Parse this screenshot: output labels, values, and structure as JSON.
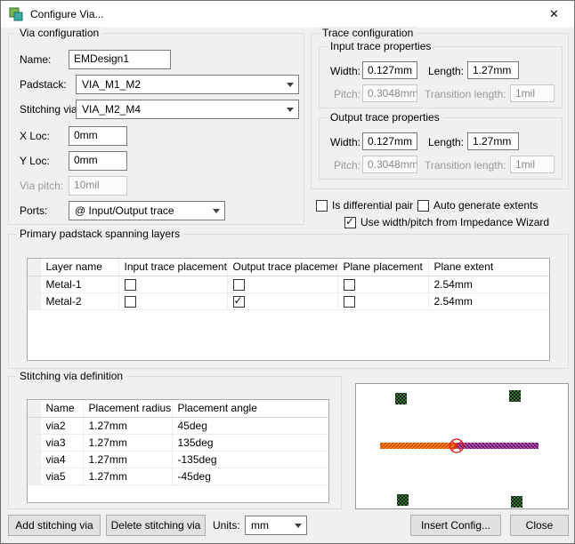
{
  "window": {
    "title": "Configure Via...",
    "close_icon": "✕"
  },
  "via_config": {
    "title": "Via configuration",
    "name_label": "Name:",
    "name_value": "EMDesign1",
    "padstack_label": "Padstack:",
    "padstack_value": "VIA_M1_M2",
    "stitching_label": "Stitching via:",
    "stitching_value": "VIA_M2_M4",
    "xloc_label": "X Loc:",
    "xloc_value": "0mm",
    "yloc_label": "Y Loc:",
    "yloc_value": "0mm",
    "viapitch_label": "Via pitch:",
    "viapitch_value": "10mil",
    "ports_label": "Ports:",
    "ports_value": "@ Input/Output trace"
  },
  "trace_config": {
    "title": "Trace configuration",
    "input": {
      "title": "Input trace properties",
      "width_label": "Width:",
      "width_value": "0.127mm",
      "length_label": "Length:",
      "length_value": "1.27mm",
      "pitch_label": "Pitch:",
      "pitch_value": "0.3048mm",
      "transition_label": "Transition length:",
      "transition_value": "1mil"
    },
    "output": {
      "title": "Output trace properties",
      "width_label": "Width:",
      "width_value": "0.127mm",
      "length_label": "Length:",
      "length_value": "1.27mm",
      "pitch_label": "Pitch:",
      "pitch_value": "0.3048mm",
      "transition_label": "Transition length:",
      "transition_value": "1mil"
    },
    "diff_pair_label": "Is differential pair",
    "diff_pair_checked": false,
    "auto_extents_label": "Auto generate extents",
    "auto_extents_checked": false,
    "impedance_label": "Use width/pitch from Impedance Wizard",
    "impedance_checked": true
  },
  "padstack_layers": {
    "title": "Primary padstack spanning layers",
    "columns": [
      "Layer name",
      "Input trace placement",
      "Output trace placement",
      "Plane placement",
      "Plane extent"
    ],
    "rows": [
      {
        "layer": "Metal-1",
        "input": false,
        "output": false,
        "plane": false,
        "extent": "2.54mm"
      },
      {
        "layer": "Metal-2",
        "input": false,
        "output": true,
        "plane": false,
        "extent": "2.54mm"
      }
    ]
  },
  "stitching": {
    "title": "Stitching via definition",
    "columns": [
      "Name",
      "Placement radius",
      "Placement angle"
    ],
    "rows": [
      {
        "name": "via2",
        "radius": "1.27mm",
        "angle": "45deg"
      },
      {
        "name": "via3",
        "radius": "1.27mm",
        "angle": "135deg"
      },
      {
        "name": "via4",
        "radius": "1.27mm",
        "angle": "-135deg"
      },
      {
        "name": "via5",
        "radius": "1.27mm",
        "angle": "-45deg"
      }
    ]
  },
  "footer": {
    "add_label": "Add stitching via",
    "delete_label": "Delete stitching via",
    "units_label": "Units:",
    "units_value": "mm",
    "insert_label": "Insert Config...",
    "close_label": "Close"
  },
  "preview": {
    "via_hatch_color": "#48a048",
    "via_hatch_line_color": "#101010",
    "input_trace_color": "#f08020",
    "input_hatch_line_color": "#c83200",
    "output_trace_color": "#b44cb4",
    "output_hatch_line_color": "#3c003c",
    "marker_color": "#e01010"
  }
}
